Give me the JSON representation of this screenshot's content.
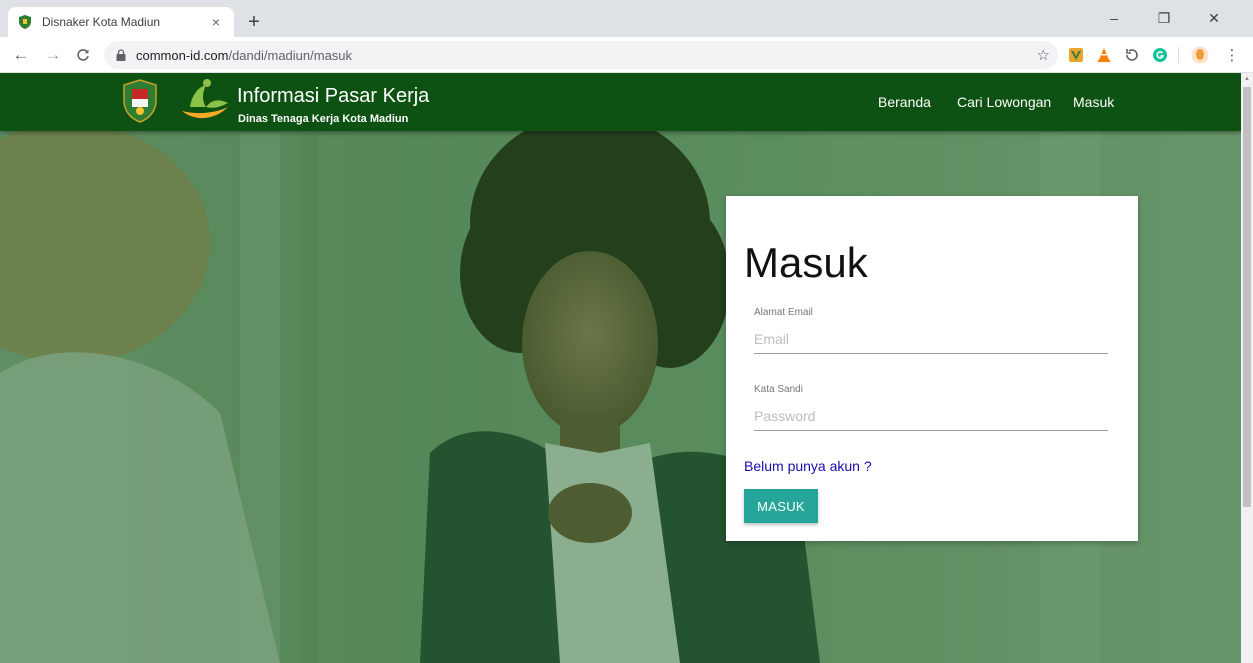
{
  "browser": {
    "tab": {
      "title": "Disnaker Kota Madiun",
      "close_symbol": "×"
    },
    "new_tab_symbol": "+",
    "window_controls": {
      "minimize": "–",
      "maximize": "❐",
      "close": "✕"
    },
    "nav": {
      "back": "←",
      "forward": "→",
      "reload": "C"
    },
    "url": {
      "host": "common-id.com",
      "path": "/dandi/madiun/masuk"
    },
    "bookmark_symbol": "☆",
    "extensions": [
      "vivaldi-extension-icon",
      "vlc-extension-icon",
      "history-extension-icon",
      "grammarly-extension-icon",
      "profile-avatar-icon"
    ],
    "menu_symbol": "⋮"
  },
  "header": {
    "title": "Informasi Pasar Kerja",
    "subtitle": "Dinas Tenaga Kerja Kota Madiun",
    "nav": [
      {
        "label": "Beranda"
      },
      {
        "label": "Cari Lowongan"
      },
      {
        "label": "Masuk"
      }
    ]
  },
  "login": {
    "title": "Masuk",
    "email": {
      "label": "Alamat Email",
      "placeholder": "Email",
      "value": ""
    },
    "password": {
      "label": "Kata Sandi",
      "placeholder": "Password",
      "value": ""
    },
    "signup_link": "Belum punya akun ?",
    "submit": "MASUK"
  },
  "colors": {
    "header_bg": "#0d5212",
    "button": "#26a69a",
    "link": "#1a0dab",
    "overlay": "#186020"
  }
}
